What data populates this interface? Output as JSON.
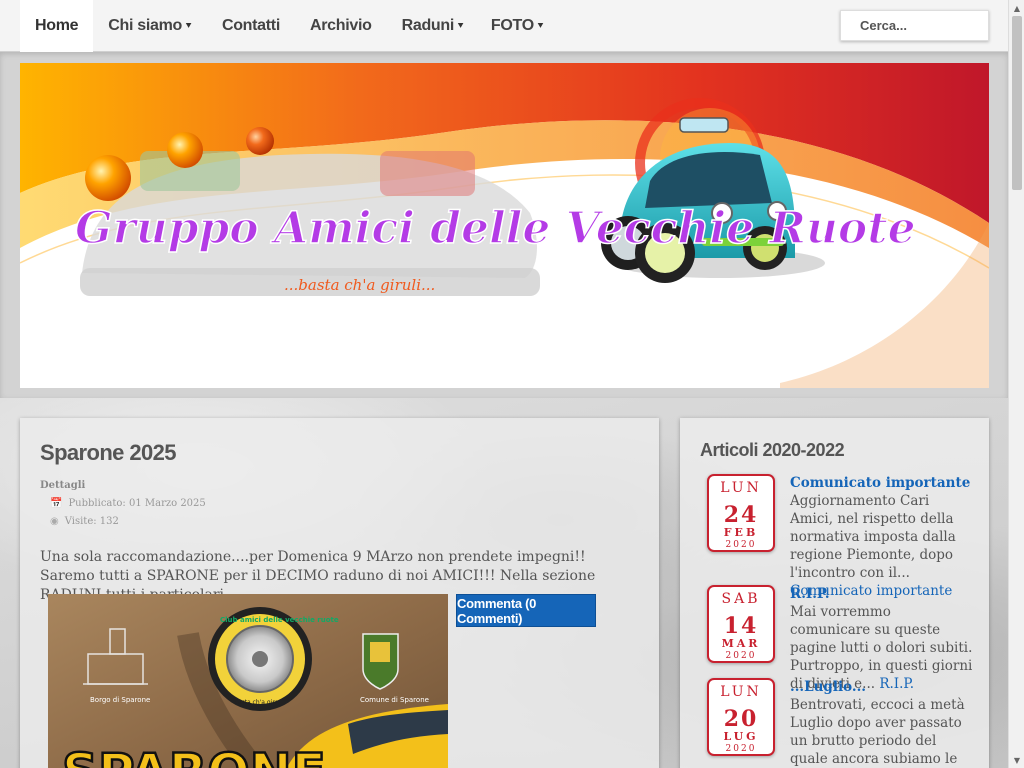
{
  "nav": {
    "items": [
      {
        "label": "Home",
        "dropdown": false,
        "active": true
      },
      {
        "label": "Chi siamo",
        "dropdown": true,
        "active": false
      },
      {
        "label": "Contatti",
        "dropdown": false,
        "active": false
      },
      {
        "label": "Archivio",
        "dropdown": false,
        "active": false
      },
      {
        "label": "Raduni",
        "dropdown": true,
        "active": false
      },
      {
        "label": "FOTO",
        "dropdown": true,
        "active": false
      }
    ],
    "search_placeholder": "Cerca..."
  },
  "banner": {
    "title": "Gruppo Amici delle Vecchie Ruote",
    "tagline": "...basta ch'a giruli..."
  },
  "article": {
    "title": "Sparone 2025",
    "details_label": "Dettagli",
    "published": "Pubblicato: 01 Marzo 2025",
    "visits": "Visite: 132",
    "body": "Una sola raccomandazione....per Domenica 9 MArzo non prendete impegni!! Saremo tutti a SPARONE per il DECIMO raduno di noi AMICI!!! Nella sezione RADUNI tutti i particolari",
    "comment_button": "Commenta (0 Commenti)",
    "poster": {
      "left_caption": "Borgo di Sparone",
      "club_text": "Club amici delle vecchie ruote",
      "club_sub": "basta ch'a gira",
      "right_caption": "Comune di Sparone",
      "headline": "SPARONE"
    }
  },
  "sidebar": {
    "title": "Articoli 2020-2022",
    "posts": [
      {
        "dow": "LUN",
        "day": "24",
        "month": "FEB",
        "year": "2020",
        "title": "Comunicato importante",
        "excerpt": "Aggiornamento Cari Amici, nel rispetto della normativa imposta dalla regione Piemonte, dopo l'incontro con il...",
        "link": "Comunicato importante"
      },
      {
        "dow": "SAB",
        "day": "14",
        "month": "MAR",
        "year": "2020",
        "title": "R.I.P.",
        "excerpt": "Mai vorremmo comunicare su queste pagine lutti o dolori subiti. Purtroppo, in questi giorni di divieti e...",
        "link": "R.I.P."
      },
      {
        "dow": "LUN",
        "day": "20",
        "month": "LUG",
        "year": "2020",
        "title": "...Luglio...",
        "excerpt": "Bentrovati, eccoci a metà Luglio dopo aver passato un brutto periodo del quale ancora subiamo le conseguenze...",
        "link": ""
      }
    ]
  },
  "colors": {
    "accent_blue": "#1565b8",
    "calendar_red": "#c8212f",
    "banner_purple": "#b43be6",
    "banner_orange": "#f05a1e"
  }
}
